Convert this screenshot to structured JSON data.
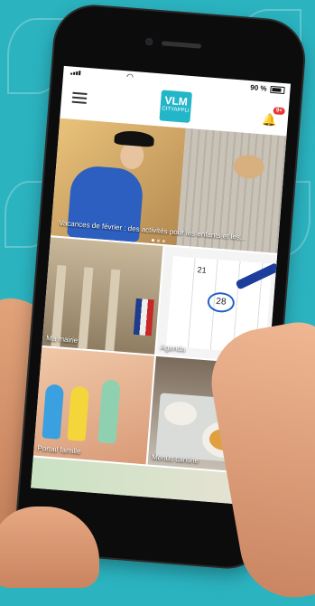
{
  "status": {
    "battery": "90 %"
  },
  "appbar": {
    "logo_line1": "VLM",
    "logo_line2": "CITYAPPLI",
    "notif_badge": "9+"
  },
  "hero": {
    "caption": "Vacances de février : des activités pour les enfants et les..."
  },
  "tiles": [
    {
      "label": "Ma mairie"
    },
    {
      "label": "Agenda"
    },
    {
      "label": "Portail famille"
    },
    {
      "label": "Menus cantine"
    }
  ],
  "agenda": {
    "date_21": "21",
    "date_28": "28"
  },
  "colors": {
    "background": "#2bb3c0",
    "logo": "#23b5c8",
    "badge": "#e53935"
  },
  "icons": {
    "menu": "hamburger-icon",
    "bell": "bell-icon",
    "wifi": "wifi-icon",
    "signal": "signal-icon",
    "battery": "battery-icon"
  }
}
